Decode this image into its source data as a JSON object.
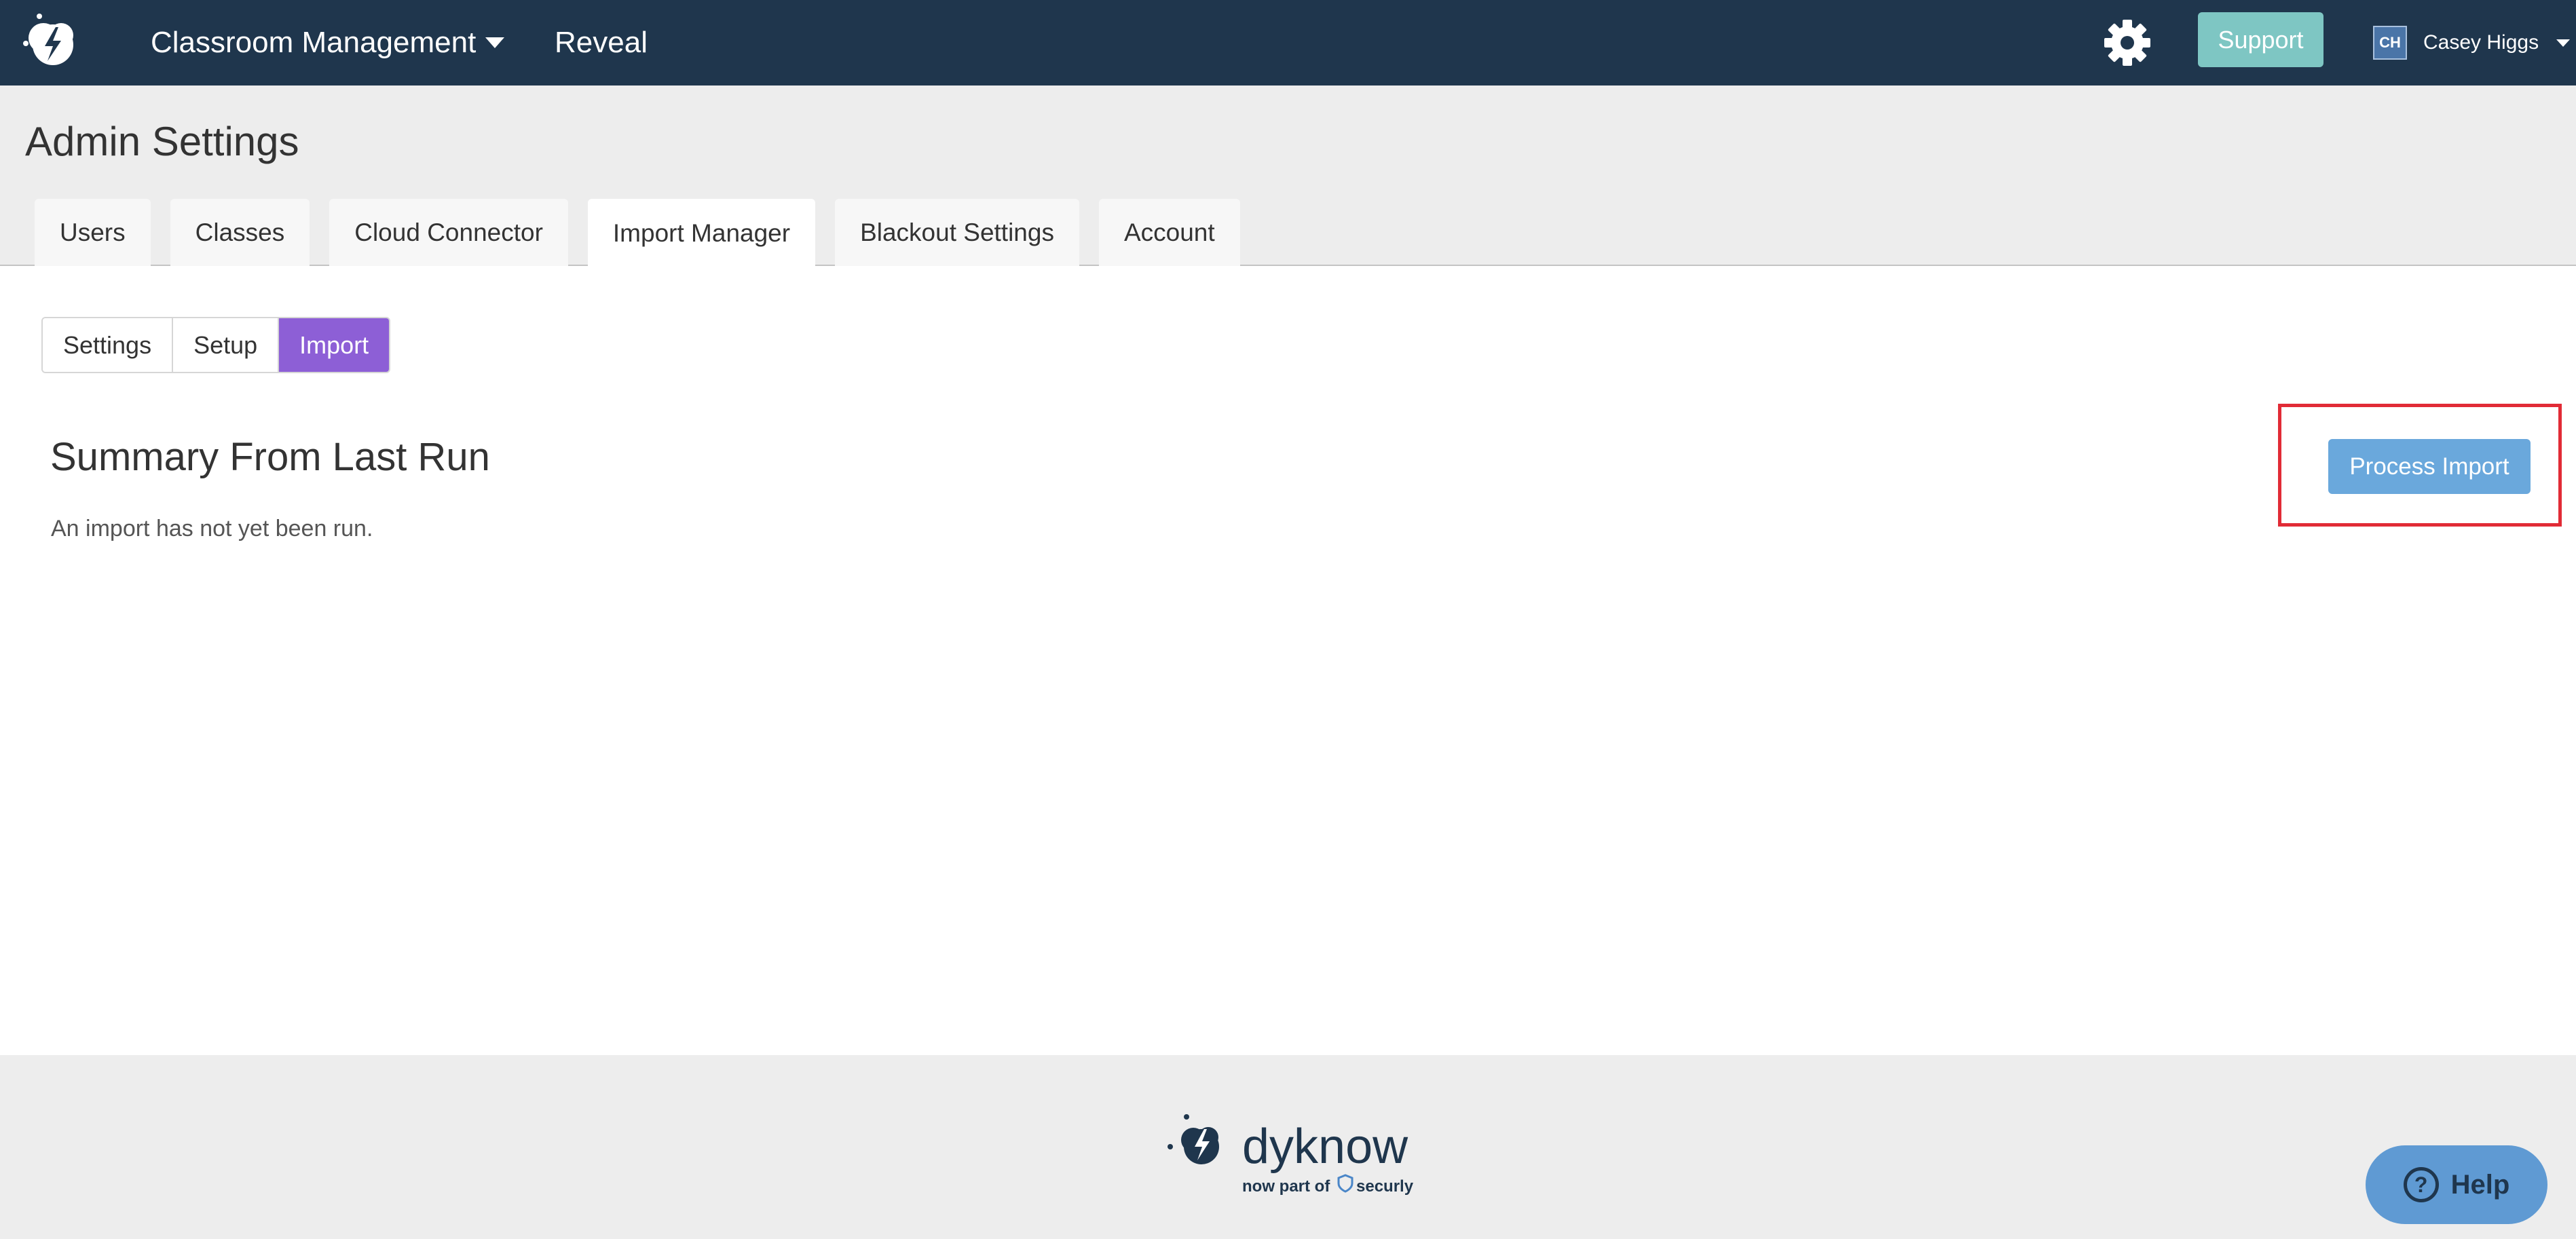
{
  "nav": {
    "product_menu_label": "Classroom Management",
    "reveal_label": "Reveal",
    "support_label": "Support",
    "user_initials": "CH",
    "user_name": "Casey Higgs"
  },
  "page": {
    "title": "Admin Settings"
  },
  "tabs": [
    {
      "label": "Users",
      "active": false
    },
    {
      "label": "Classes",
      "active": false
    },
    {
      "label": "Cloud Connector",
      "active": false
    },
    {
      "label": "Import Manager",
      "active": true
    },
    {
      "label": "Blackout Settings",
      "active": false
    },
    {
      "label": "Account",
      "active": false
    }
  ],
  "subtabs": [
    {
      "label": "Settings",
      "active": false
    },
    {
      "label": "Setup",
      "active": false
    },
    {
      "label": "Import",
      "active": true
    }
  ],
  "summary": {
    "title": "Summary From Last Run",
    "text": "An import has not yet been run.",
    "process_button_label": "Process Import"
  },
  "footer": {
    "brand": "dyknow",
    "tagline_prefix": "now part of",
    "partner": "securly"
  },
  "help": {
    "label": "Help"
  },
  "colors": {
    "nav_bg": "#1f364d",
    "support_bg": "#7ec6c3",
    "active_subtab": "#8d5fd6",
    "process_button": "#6aa8dc",
    "highlight": "#e12b36",
    "help_bg": "#5f9ad3"
  },
  "icons": {
    "app_logo": "dyknow-bolt-logo",
    "settings": "gear-icon",
    "help": "question-circle-icon"
  }
}
